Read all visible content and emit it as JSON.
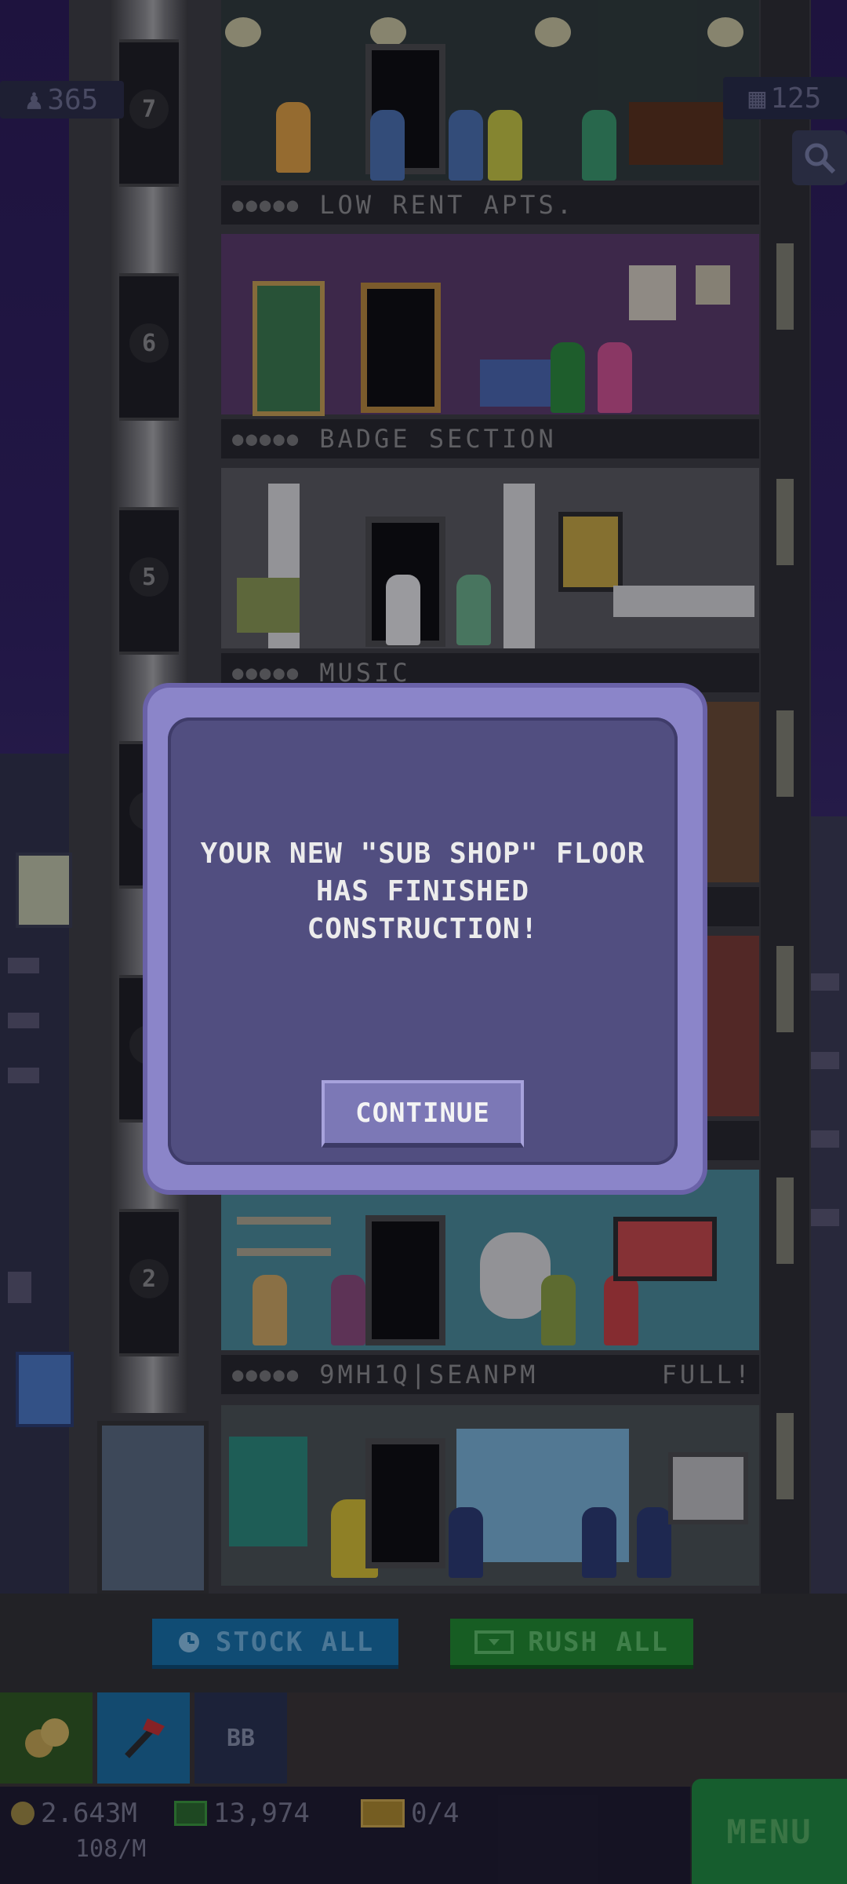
{
  "hud": {
    "population": "365",
    "floors": "125"
  },
  "floors": [
    {
      "number": "7",
      "name": "LOW RENT APTS.",
      "status": ""
    },
    {
      "number": "6",
      "name": "BADGE SECTION",
      "status": ""
    },
    {
      "number": "5",
      "name": "MUSIC",
      "status": ""
    },
    {
      "number": "4",
      "name": "",
      "status": ""
    },
    {
      "number": "3",
      "name": "",
      "status": ""
    },
    {
      "number": "2",
      "name": "9MH1Q|SEANPM",
      "status": "FULL!"
    }
  ],
  "dialog": {
    "message": "YOUR NEW \"SUB SHOP\" FLOOR HAS FINISHED CONSTRUCTION!",
    "button": "CONTINUE"
  },
  "actions": {
    "stock_all": "STOCK ALL",
    "rush_all": "RUSH ALL"
  },
  "tabs": {
    "bb_label": "BB"
  },
  "status": {
    "coins": "2.643M",
    "coins_rate": "108/M",
    "bux": "13,974",
    "tickets": "0/4"
  },
  "menu": "MENU",
  "colors": {
    "dialog_outer": "#8b85c9",
    "dialog_inner": "#514e80",
    "stock_button": "#1570a8",
    "rush_button": "#1f8a2b",
    "menu_button": "#1e8a3c"
  }
}
